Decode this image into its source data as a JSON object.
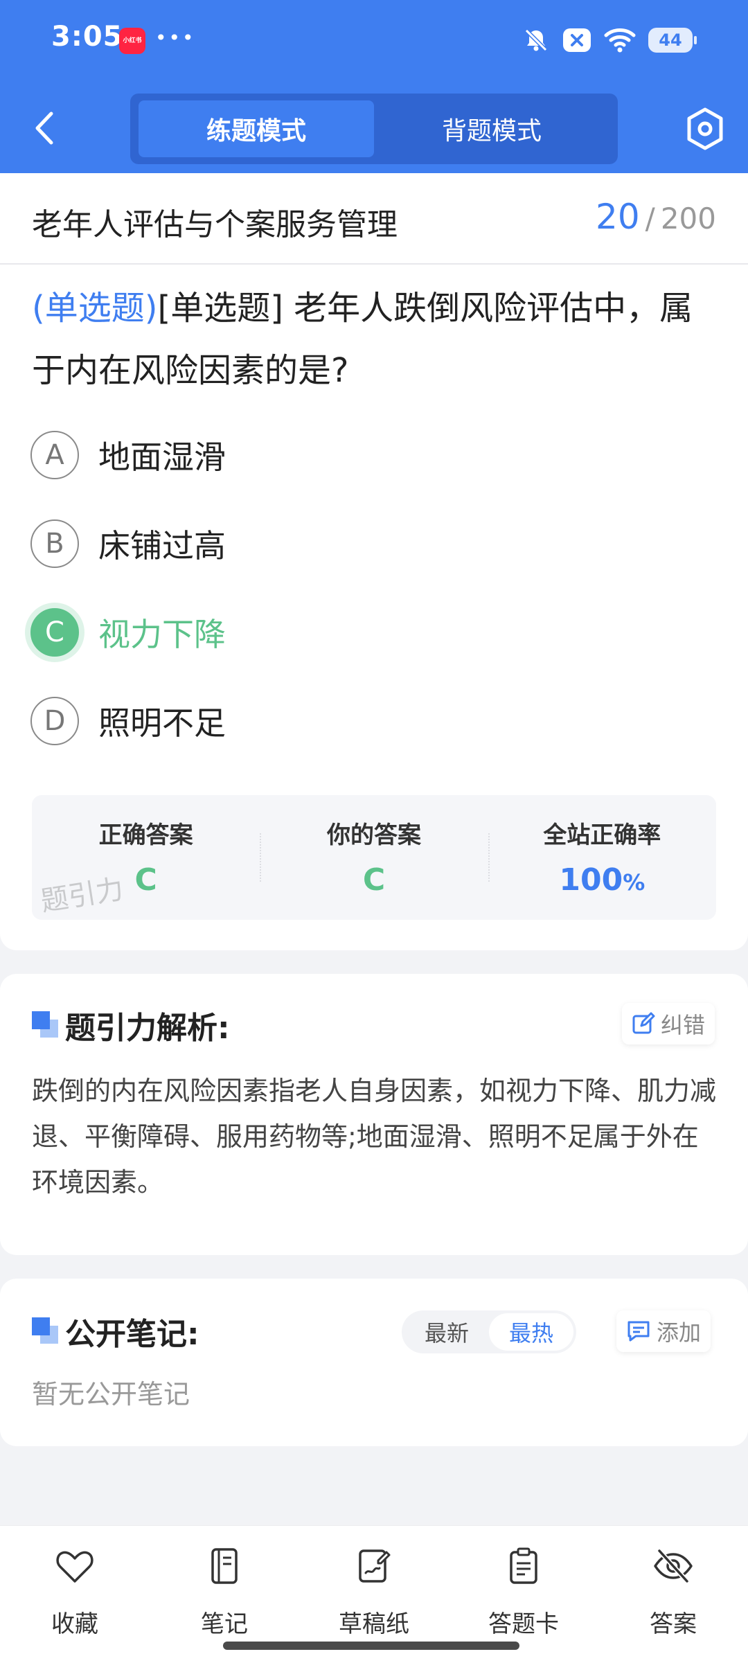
{
  "status_bar": {
    "time": "3:05",
    "app_icon_label": "小红书",
    "more_dots": "•••",
    "battery": "44"
  },
  "header": {
    "modes": [
      {
        "label": "练题模式",
        "active": true
      },
      {
        "label": "背题模式",
        "active": false
      }
    ]
  },
  "question": {
    "subject": "老年人评估与个案服务管理",
    "current": "20",
    "separator": "/",
    "total": "200",
    "type_tag": "(单选题)",
    "text": "[单选题] 老年人跌倒风险评估中，属于内在风险因素的是?",
    "options": [
      {
        "letter": "A",
        "text": "地面湿滑"
      },
      {
        "letter": "B",
        "text": "床铺过高"
      },
      {
        "letter": "C",
        "text": "视力下降",
        "correct": true
      },
      {
        "letter": "D",
        "text": "照明不足"
      }
    ]
  },
  "answer_panel": {
    "correct_label": "正确答案",
    "correct_value": "C",
    "yours_label": "你的答案",
    "yours_value": "C",
    "rate_label": "全站正确率",
    "rate_value": "100",
    "rate_unit": "%",
    "watermark": "题引力"
  },
  "analysis": {
    "title": "题引力解析:",
    "report_label": "纠错",
    "body": "跌倒的内在风险因素指老人自身因素，如视力下降、肌力减退、平衡障碍、服用药物等;地面湿滑、照明不足属于外在环境因素。"
  },
  "notes": {
    "title": "公开笔记:",
    "sort_options": [
      "最新",
      "最热"
    ],
    "sort_active": "最热",
    "add_label": "添加",
    "empty_text": "暂无公开笔记"
  },
  "bottom_nav": [
    {
      "label": "收藏",
      "icon": "heart-icon"
    },
    {
      "label": "笔记",
      "icon": "notebook-icon"
    },
    {
      "label": "草稿纸",
      "icon": "draft-paper-icon"
    },
    {
      "label": "答题卡",
      "icon": "answer-card-icon"
    },
    {
      "label": "答案",
      "icon": "eye-off-icon"
    }
  ],
  "colors": {
    "primary": "#3f7ef0",
    "correct": "#5cc28a"
  }
}
